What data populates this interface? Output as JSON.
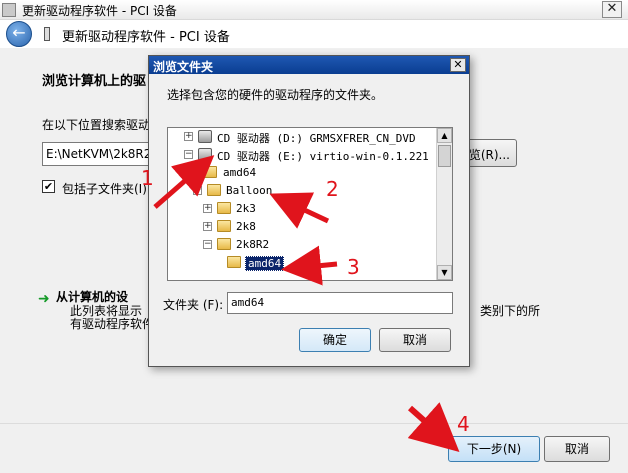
{
  "window": {
    "title": "更新驱动程序软件 - PCI 设备",
    "close_glyph": "✕"
  },
  "nav": {
    "back_glyph": "←",
    "title": "更新驱动程序软件 - PCI 设备"
  },
  "main": {
    "heading": "浏览计算机上的驱",
    "search_label": "在以下位置搜索驱动",
    "path_value": "E:\\NetKVM\\2k8R2",
    "browse_button": "览(R)...",
    "include_subfolders": {
      "checked": true,
      "check_glyph": "✔",
      "label": "包括子文件夹(I)"
    },
    "pick": {
      "arrow_glyph": "➜",
      "title": "从计算机的设",
      "desc_line1": "此列表将显示",
      "desc_line2": "有驱动程序软件",
      "desc_tail": "类别下的所"
    }
  },
  "footer": {
    "next_button": "下一步(N)",
    "cancel_button": "取消"
  },
  "dialog": {
    "title": "浏览文件夹",
    "close_glyph": "✕",
    "instruction": "选择包含您的硬件的驱动程序的文件夹。",
    "tree": [
      {
        "label": "CD 驱动器 (D:) GRMSXFRER_CN_DVD",
        "expander": "+",
        "icon": "cd-drive-icon"
      },
      {
        "label": "CD 驱动器 (E:) virtio-win-0.1.221",
        "expander": "−",
        "icon": "cd-drive-icon"
      },
      {
        "label": "amd64",
        "expander": "",
        "icon": "folder-icon"
      },
      {
        "label": "Balloon",
        "expander": "−",
        "icon": "folder-icon"
      },
      {
        "label": "2k3",
        "expander": "+",
        "icon": "folder-icon"
      },
      {
        "label": "2k8",
        "expander": "+",
        "icon": "folder-icon"
      },
      {
        "label": "2k8R2",
        "expander": "−",
        "icon": "folder-icon"
      },
      {
        "label": "amd64",
        "expander": "",
        "icon": "folder-icon",
        "selected": true
      }
    ],
    "scroll_up_glyph": "▲",
    "scroll_down_glyph": "▼",
    "folder_label": "文件夹 (F):",
    "folder_value": "amd64",
    "ok_button": "确定",
    "cancel_button": "取消"
  },
  "annotations": {
    "color": "#e0141c",
    "numbers": [
      "1",
      "2",
      "3",
      "4"
    ]
  }
}
